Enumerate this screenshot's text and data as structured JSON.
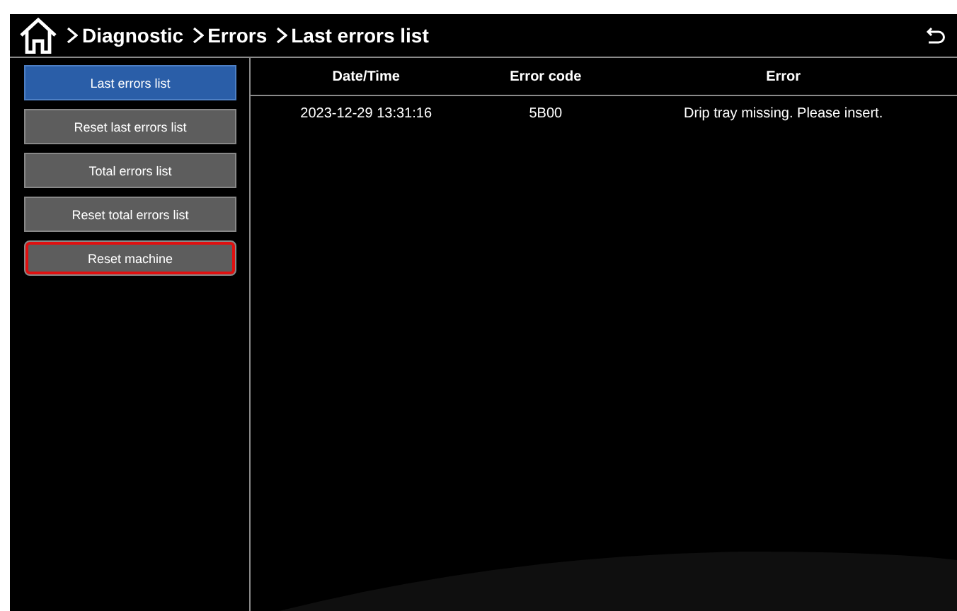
{
  "breadcrumb": [
    {
      "label": "Diagnostic"
    },
    {
      "label": "Errors"
    },
    {
      "label": "Last errors list"
    }
  ],
  "menu": [
    {
      "label": "Last errors list",
      "selected": true,
      "focused": false
    },
    {
      "label": "Reset last errors list",
      "selected": false,
      "focused": false
    },
    {
      "label": "Total errors list",
      "selected": false,
      "focused": false
    },
    {
      "label": "Reset total errors list",
      "selected": false,
      "focused": false
    },
    {
      "label": "Reset machine",
      "selected": false,
      "focused": true
    }
  ],
  "table": {
    "columns": [
      "Date/Time",
      "Error code",
      "Error"
    ],
    "rows": [
      [
        "2023-12-29 13:31:16",
        "5B00",
        "Drip tray missing. Please insert."
      ]
    ]
  }
}
